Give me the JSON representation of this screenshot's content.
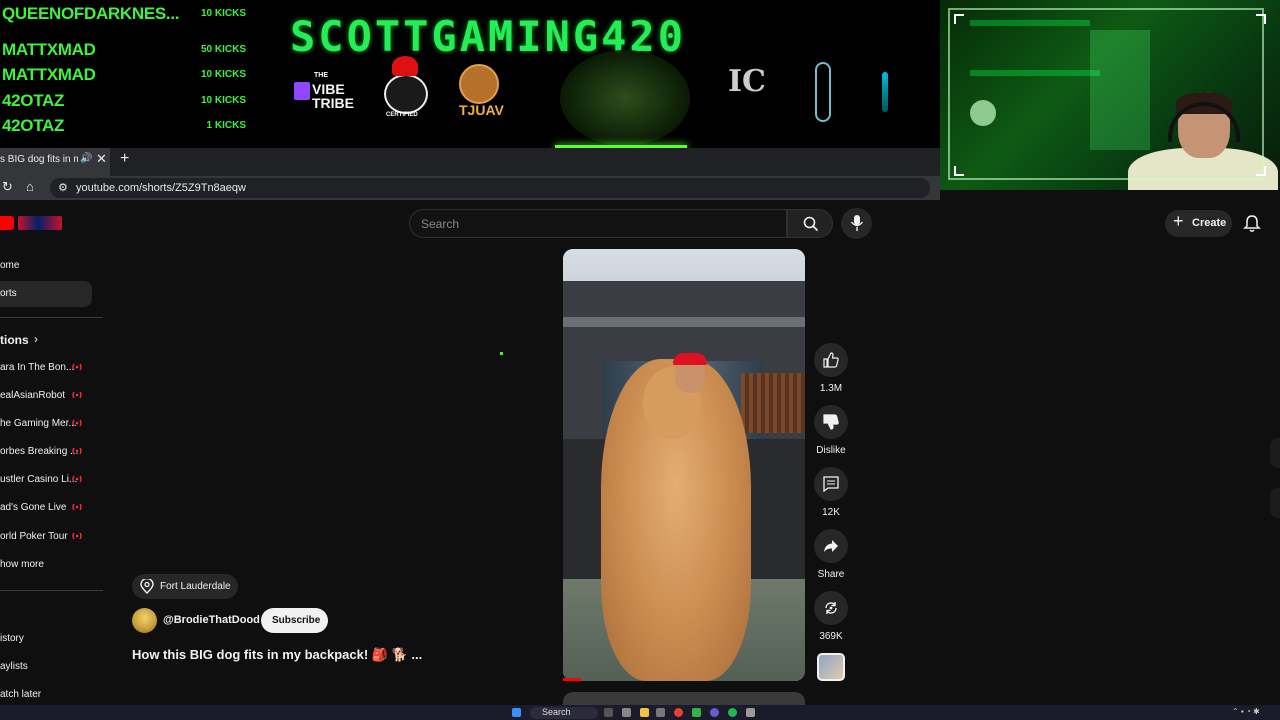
{
  "overlay": {
    "kicks": [
      {
        "name": "QUEENOFDARKNES...",
        "count": "10 KICKS"
      },
      {
        "name": "MATTXMAD",
        "count": "50 KICKS"
      },
      {
        "name": "MATTXMAD",
        "count": "10 KICKS"
      },
      {
        "name": "42OTAZ",
        "count": "10 KICKS"
      },
      {
        "name": "42OTAZ",
        "count": "1 KICKS"
      }
    ],
    "title": "SCOTTGAMING420",
    "logos": {
      "vibe_small": "THE",
      "vibe": "VIBE TRIBE",
      "certified": "CERTIFIED",
      "tjuav": "TJUAV",
      "ic": "IC"
    }
  },
  "browser": {
    "tab_title": "s BIG dog fits in my",
    "url": "youtube.com/shorts/Z5Z9Tn8aeqw"
  },
  "youtube": {
    "search_placeholder": "Search",
    "create_label": "Create",
    "sidebar": {
      "items": [
        "ome",
        "orts"
      ],
      "subscriptions_heading": "tions",
      "channels": [
        "ara In The Bon...",
        "ealAsianRobot",
        "he Gaming Mer...",
        "orbes Breaking ...",
        "ustler Casino Li...",
        "ad's Gone Live",
        "orld Poker Tour",
        "how more"
      ],
      "you_items": [
        "istory",
        "aylists",
        "atch later"
      ]
    },
    "actions": [
      {
        "icon": "thumbs-up-icon",
        "label": "1.3M"
      },
      {
        "icon": "thumbs-down-icon",
        "label": "Dislike"
      },
      {
        "icon": "comment-icon",
        "label": "12K"
      },
      {
        "icon": "share-icon",
        "label": "Share"
      },
      {
        "icon": "remix-icon",
        "label": "369K"
      }
    ],
    "location": "Fort Lauderdale",
    "channel": "@BrodieThatDood",
    "subscribe_label": "Subscribe",
    "video_title": "How this BIG dog fits in my backpack! 🎒 🐕 ..."
  },
  "taskbar": {
    "search_label": "Search"
  },
  "colors": {
    "overlay_green": "#3ef23e",
    "youtube_red": "#ff0000",
    "background": "#0f0f0f"
  }
}
